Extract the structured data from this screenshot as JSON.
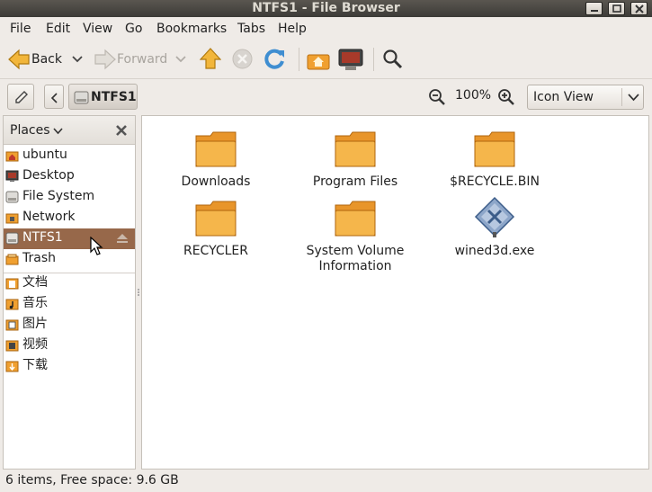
{
  "window": {
    "title": "NTFS1 - File Browser"
  },
  "menubar": [
    "File",
    "Edit",
    "View",
    "Go",
    "Bookmarks",
    "Tabs",
    "Help"
  ],
  "toolbar": {
    "back": "Back",
    "forward": "Forward"
  },
  "location": {
    "crumb": "NTFS1",
    "zoom": "100%",
    "view_mode": "Icon View"
  },
  "sidebar": {
    "header": "Places",
    "places": [
      {
        "label": "ubuntu",
        "icon": "home-icon"
      },
      {
        "label": "Desktop",
        "icon": "desktop-icon"
      },
      {
        "label": "File System",
        "icon": "drive-icon"
      },
      {
        "label": "Network",
        "icon": "network-icon"
      },
      {
        "label": "NTFS1",
        "icon": "drive-icon",
        "selected": true
      },
      {
        "label": "Trash",
        "icon": "trash-icon"
      }
    ],
    "bookmarks": [
      {
        "label": "文档",
        "icon": "documents-folder-icon"
      },
      {
        "label": "音乐",
        "icon": "music-folder-icon"
      },
      {
        "label": "图片",
        "icon": "pictures-folder-icon"
      },
      {
        "label": "视频",
        "icon": "videos-folder-icon"
      },
      {
        "label": "下载",
        "icon": "downloads-folder-icon"
      }
    ]
  },
  "files": [
    {
      "name": "Downloads",
      "type": "folder"
    },
    {
      "name": "Program Files",
      "type": "folder"
    },
    {
      "name": "$RECYCLE.BIN",
      "type": "folder"
    },
    {
      "name": "RECYCLER",
      "type": "folder"
    },
    {
      "name": "System Volume Information",
      "type": "folder"
    },
    {
      "name": "wined3d.exe",
      "type": "executable"
    }
  ],
  "status": {
    "text": "6 items, Free space: 9.6 GB"
  },
  "colors": {
    "selection": "#97684a",
    "folder": "#f0a030",
    "accent": "#f07746"
  }
}
